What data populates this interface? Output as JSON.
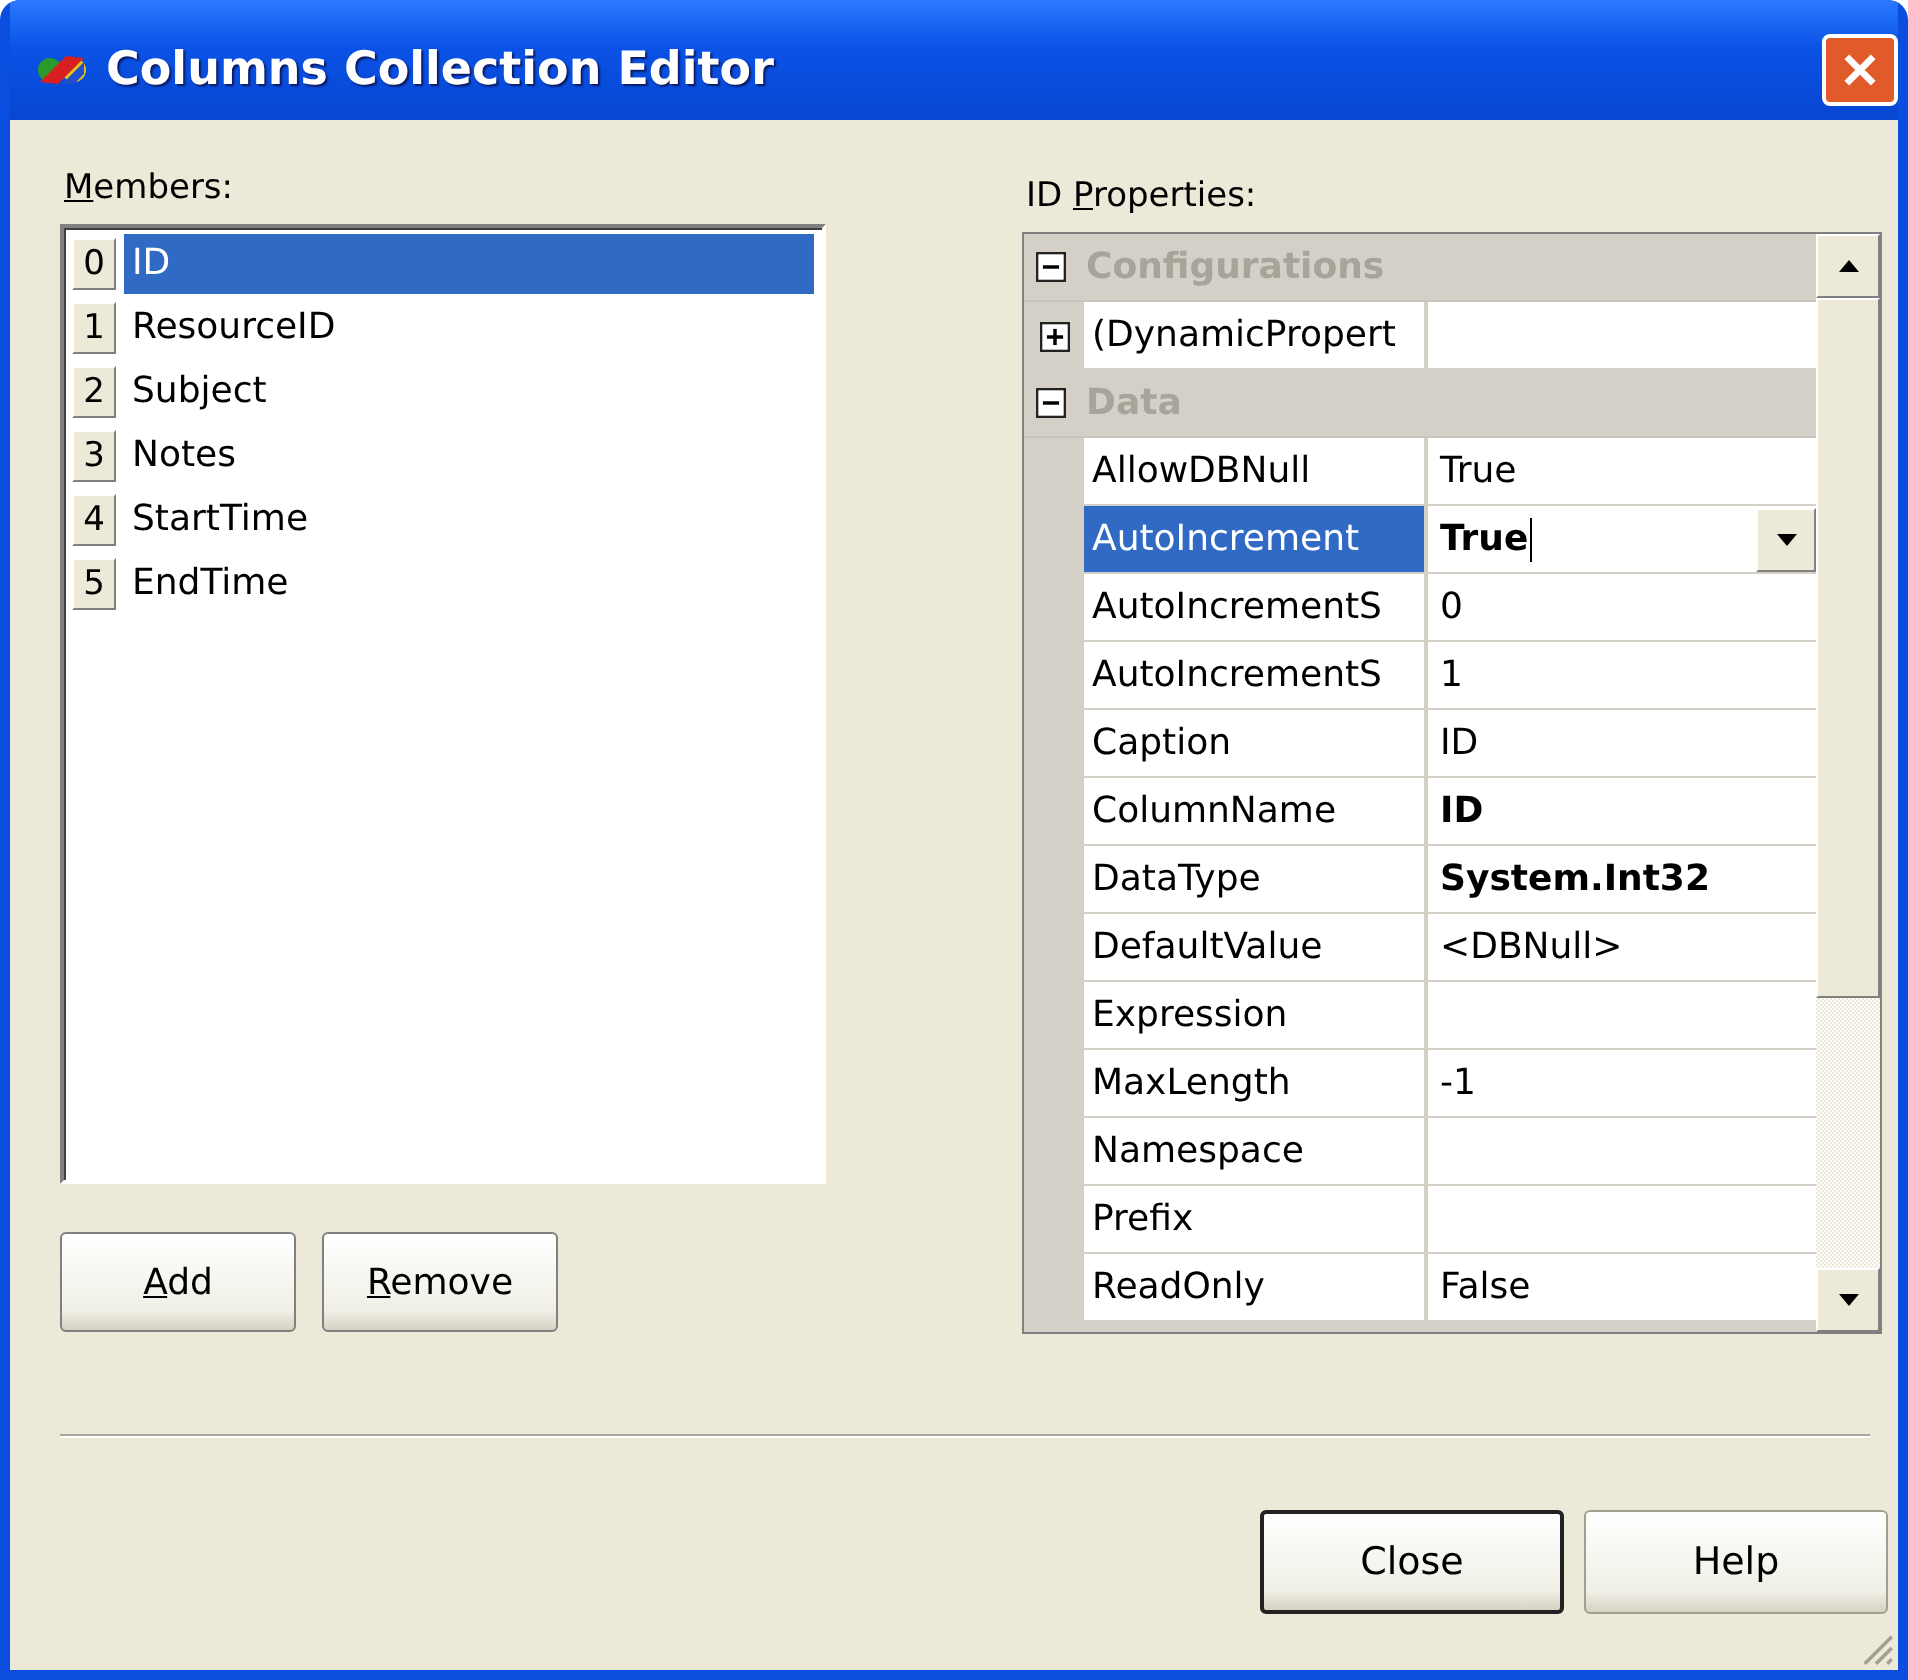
{
  "window": {
    "title": "Columns Collection Editor"
  },
  "members": {
    "label": {
      "key": "M",
      "post": "embers:"
    },
    "items": [
      {
        "index": "0",
        "name": "ID",
        "selected": true
      },
      {
        "index": "1",
        "name": "ResourceID",
        "selected": false
      },
      {
        "index": "2",
        "name": "Subject",
        "selected": false
      },
      {
        "index": "3",
        "name": "Notes",
        "selected": false
      },
      {
        "index": "4",
        "name": "StartTime",
        "selected": false
      },
      {
        "index": "5",
        "name": "EndTime",
        "selected": false
      }
    ]
  },
  "properties": {
    "label": {
      "pre": "ID ",
      "key": "P",
      "post": "roperties:"
    },
    "groups": [
      {
        "name": "Configurations",
        "expanded": true,
        "rows": [
          {
            "kind": "expandable",
            "name": "(DynamicPropert",
            "expanded": false,
            "selected": false
          }
        ]
      },
      {
        "name": "Data",
        "expanded": true,
        "rows": [
          {
            "kind": "plain",
            "name": "AllowDBNull",
            "value": "True",
            "selected": false,
            "modified": false
          },
          {
            "kind": "editing",
            "name": "AutoIncrement",
            "value": "True",
            "selected": true,
            "modified": true
          },
          {
            "kind": "plain",
            "name": "AutoIncrementS",
            "value": "0",
            "selected": false,
            "modified": false
          },
          {
            "kind": "plain",
            "name": "AutoIncrementS",
            "value": "1",
            "selected": false,
            "modified": false
          },
          {
            "kind": "plain",
            "name": "Caption",
            "value": "ID",
            "selected": false,
            "modified": false
          },
          {
            "kind": "plain",
            "name": "ColumnName",
            "value": "ID",
            "selected": false,
            "modified": true
          },
          {
            "kind": "plain",
            "name": "DataType",
            "value": "System.Int32",
            "selected": false,
            "modified": true
          },
          {
            "kind": "plain",
            "name": "DefaultValue",
            "value": "<DBNull>",
            "selected": false,
            "modified": false
          },
          {
            "kind": "plain",
            "name": "Expression",
            "selected": false
          },
          {
            "kind": "plain",
            "name": "MaxLength",
            "value": "-1",
            "selected": false,
            "modified": false
          },
          {
            "kind": "plain",
            "name": "Namespace",
            "selected": false
          },
          {
            "kind": "plain",
            "name": "Prefix",
            "selected": false
          },
          {
            "kind": "plain",
            "name": "ReadOnly",
            "value": "False",
            "selected": false,
            "modified": false
          }
        ]
      }
    ]
  },
  "list_buttons": [
    {
      "label": {
        "key": "A",
        "post": "dd"
      }
    },
    {
      "label": {
        "key": "R",
        "post": "emove"
      }
    }
  ],
  "dialog_buttons": [
    {
      "label": "Close",
      "default": true
    },
    {
      "label": "Help",
      "default": false
    }
  ]
}
